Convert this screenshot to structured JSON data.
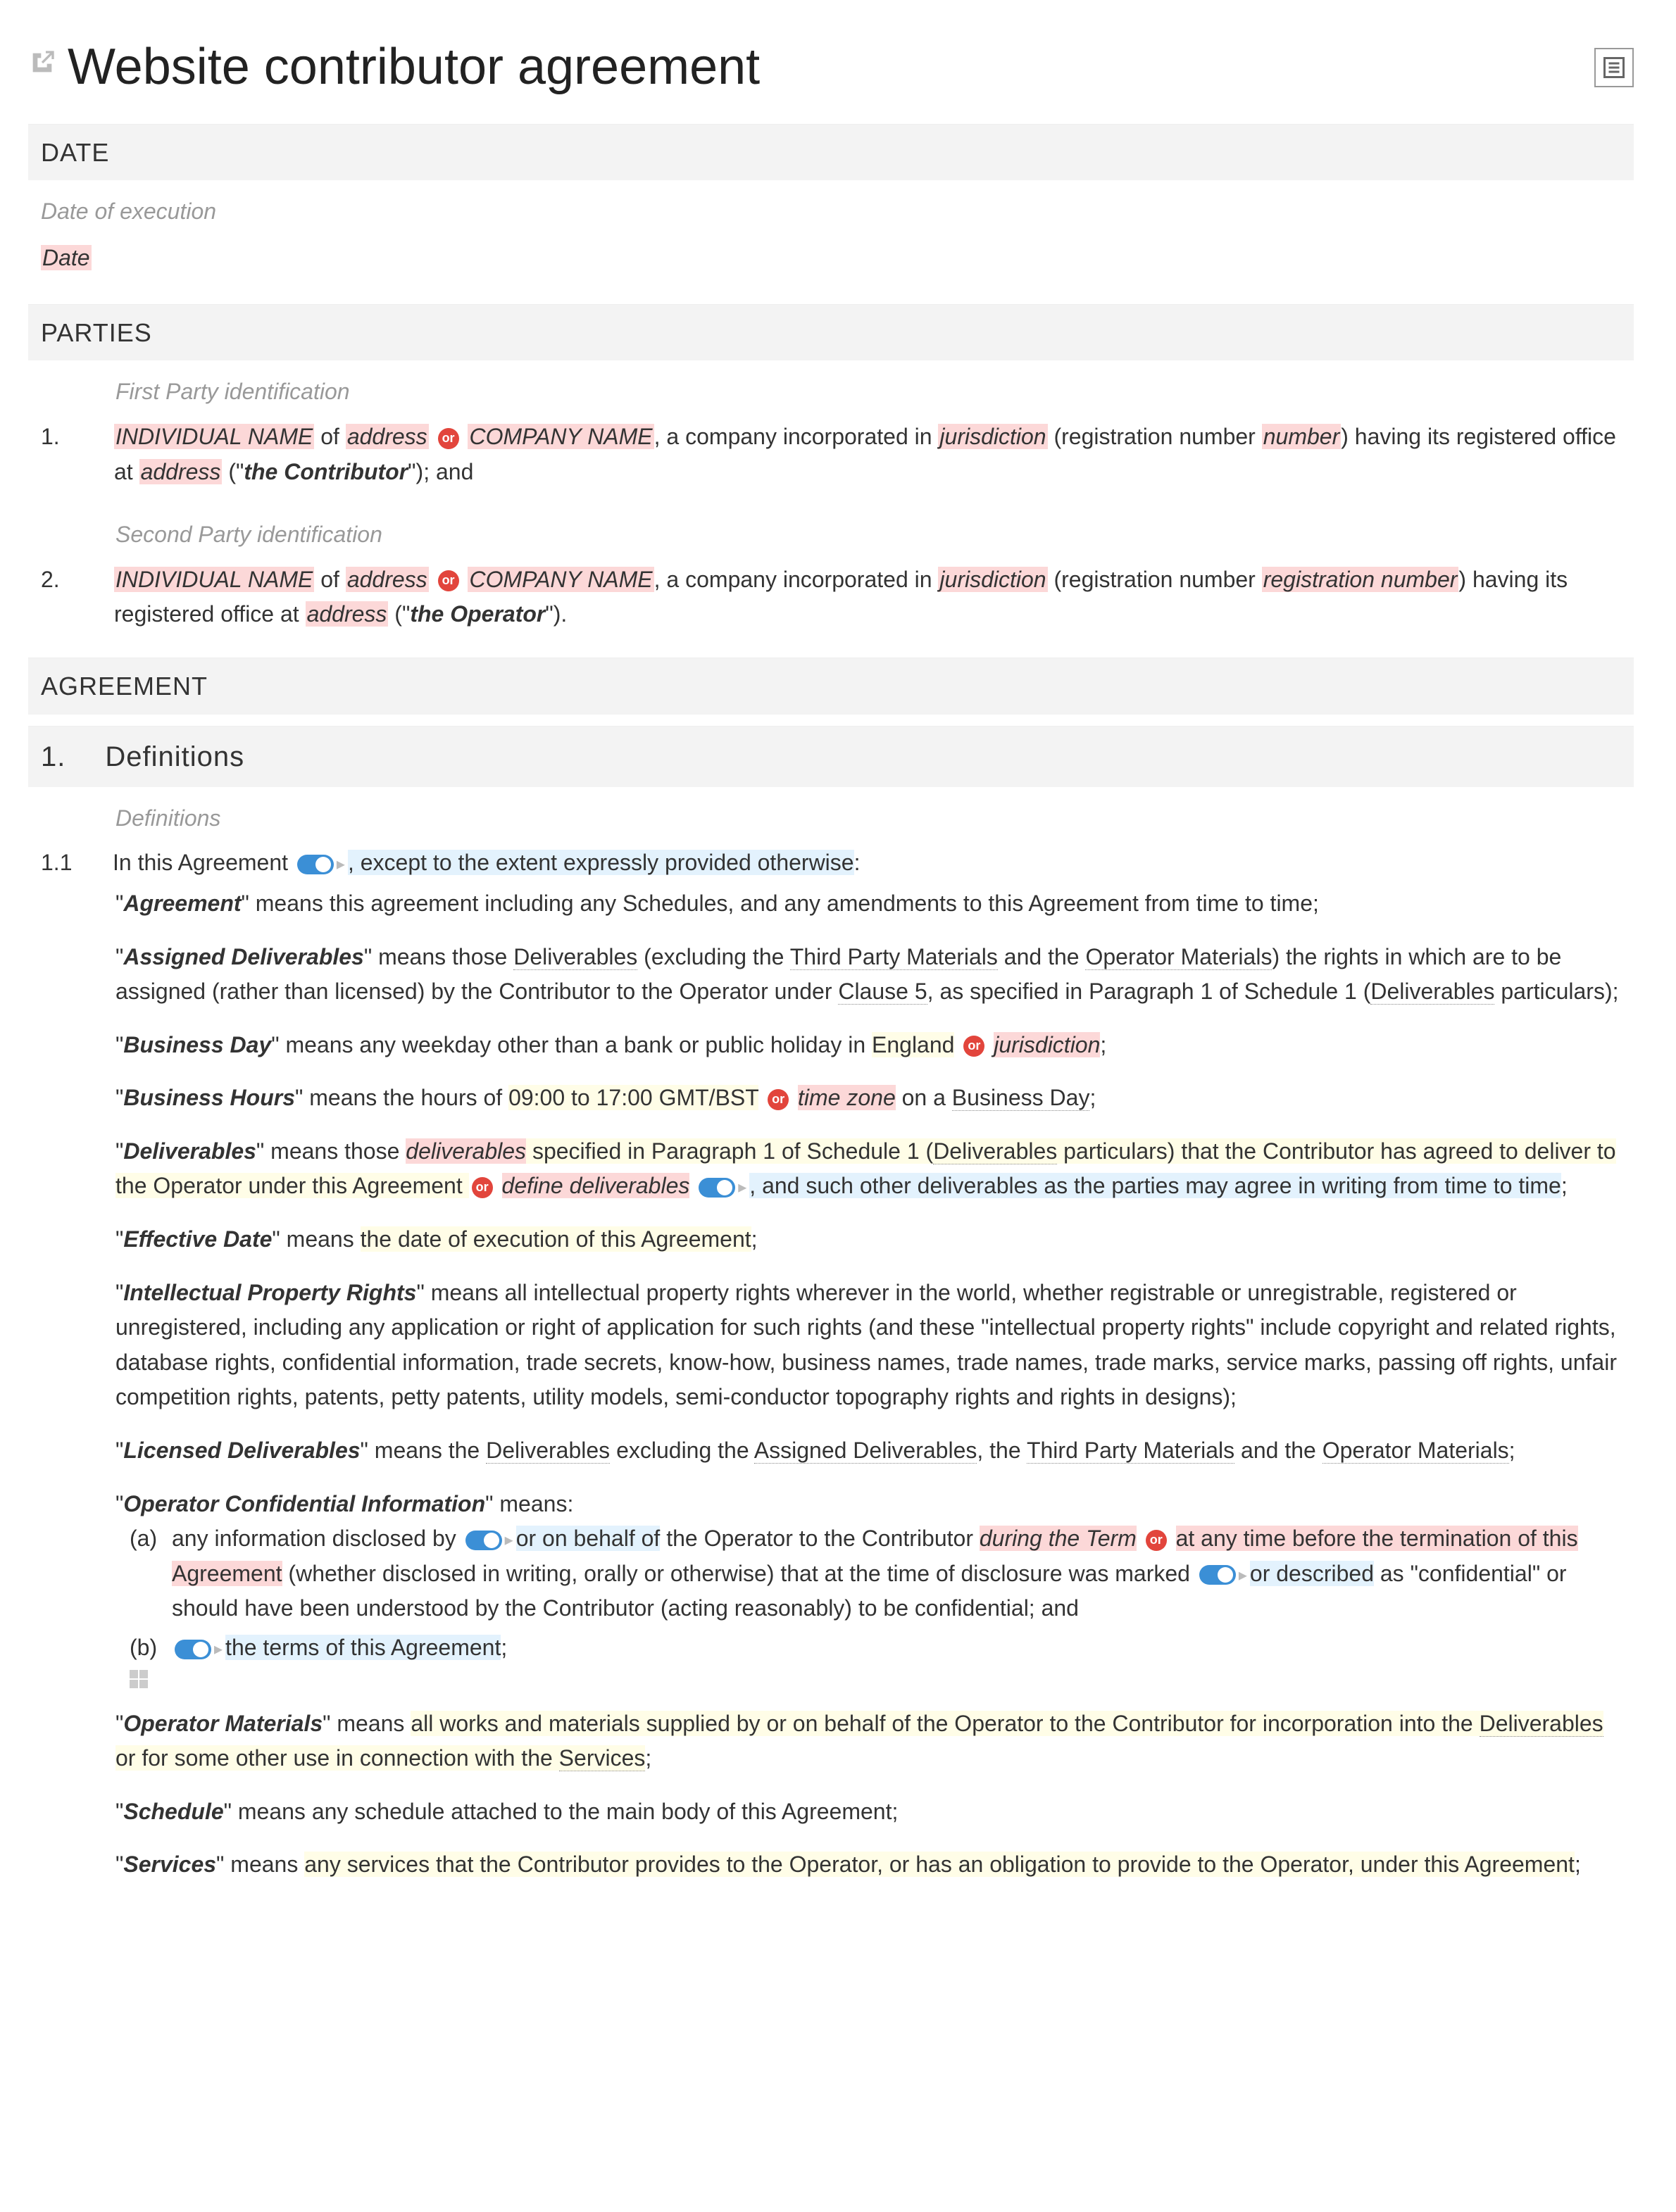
{
  "title": "Website contributor agreement",
  "sections": {
    "date": {
      "label": "DATE",
      "hint": "Date of execution",
      "placeholder": "Date"
    },
    "parties": {
      "label": "PARTIES",
      "p1_hint": "First Party identification",
      "p2_hint": "Second Party identification",
      "p1_num": "1.",
      "p2_num": "2.",
      "ph_individual": "INDIVIDUAL NAME",
      "t_of": " of ",
      "ph_address": "address",
      "or": "or",
      "ph_company": "COMPANY NAME",
      "t_company_inc": ", a company incorporated in ",
      "ph_jurisdiction": "jurisdiction",
      "t_regnum_open": " (registration number ",
      "ph_number": "number",
      "t_regnum_close": ") having its registered office at ",
      "t_open_q": " (\"",
      "role1": "the Contributor",
      "t_close_and": "\"); and",
      "ph_regnum": "registration number",
      "role2": "the Operator",
      "t_close_period": "\")."
    },
    "agreement": {
      "label": "AGREEMENT",
      "h2_num": "1.",
      "h2_title": "Definitions",
      "hint": "Definitions",
      "cl11": "1.1",
      "cl11_pre": "In this Agreement",
      "cl11_rest": ", except to the extent expressly provided otherwise",
      "cl11_colon": ":"
    }
  },
  "defs": {
    "agreement": {
      "term": "Agreement",
      "text": "\" means this agreement including any Schedules, and any amendments to this Agreement from time to time;"
    },
    "assigned": {
      "term": "Assigned Deliverables",
      "pre": "\" means those ",
      "link1": "Deliverables",
      "t2": " (excluding the ",
      "link2": "Third Party Materials",
      "t3": " and the ",
      "link3": "Operator Materials",
      "t4": ") the rights in which are to be assigned (rather than licensed) by the Contributor to the Operator under ",
      "link4": "Clause 5",
      "t5": ", as specified in Paragraph 1 of Schedule 1 (",
      "link5": "Deliverables",
      "t6": " particulars);"
    },
    "bday": {
      "term": "Business Day",
      "t1": "\" means any weekday other than a bank or public holiday in ",
      "england": "England",
      "or": "or",
      "juris": "jurisdiction",
      "semi": ";"
    },
    "bhours": {
      "term": "Business Hours",
      "t1": "\" means the hours of ",
      "hours": "09:00 to 17:00 GMT/BST",
      "or": "or",
      "tz": "time zone",
      "t2": " on a ",
      "link": "Business Day",
      "semi": ";"
    },
    "deliv": {
      "term": "Deliverables",
      "t1": "\" means those ",
      "ph1": "deliverables",
      "t2": " specified in Paragraph 1 of Schedule 1 (",
      "link1": "Deliverables",
      "t3": " particulars) that the Contributor has agreed to deliver to the Operator under this Agreement ",
      "or": "or",
      "ph2": "define deliverables",
      "t4": ", and such other deliverables as the parties may agree in writing from time to time",
      "semi": ";"
    },
    "eff": {
      "term": "Effective Date",
      "t1": "\" means ",
      "y": "the date of execution of this Agreement",
      "semi": ";"
    },
    "ipr": {
      "term": "Intellectual Property Rights",
      "body": "\" means all intellectual property rights wherever in the world, whether registrable or unregistrable, registered or unregistered, including any application or right of application for such rights (and these \"intellectual property rights\" include copyright and related rights, database rights, confidential information, trade secrets, know-how, business names, trade names, trade marks, service marks, passing off rights, unfair competition rights, patents, petty patents, utility models, semi-conductor topography rights and rights in designs);"
    },
    "licdel": {
      "term": "Licensed Deliverables",
      "t1": "\" means the ",
      "l1": "Deliverables",
      "t2": " excluding the ",
      "l2": "Assigned Deliverables",
      "t3": ", the ",
      "l3": "Third Party Materials",
      "t4": " and the ",
      "l4": "Operator Materials",
      "semi": ";"
    },
    "oci": {
      "term": "Operator Confidential Information",
      "means": "\" means:",
      "a_lbl": "(a)",
      "a_t1": "any information disclosed by ",
      "a_b1": "or on behalf of",
      "a_t2": " the Operator to the Contributor ",
      "a_p1": "during the Term",
      "a_or": "or",
      "a_p2": "at any time before the termination of this Agreement",
      "a_t3": " (whether disclosed in writing, orally or otherwise) that at the time of disclosure was marked ",
      "a_b2": "or described",
      "a_t4": " as \"confidential\" or should have been understood by the Contributor (acting reasonably) to be confidential; and",
      "b_lbl": "(b)",
      "b_t1": "the terms of this Agreement",
      "semi": ";"
    },
    "opmat": {
      "term": "Operator Materials",
      "t1": "\" means ",
      "y": "all works and materials supplied by or on behalf of the Operator to the Contributor for incorporation into the ",
      "l1": "Deliverables",
      "y2": " or for some other use in connection with the ",
      "l2": "Services",
      "semi": ";"
    },
    "sched": {
      "term": "Schedule",
      "body": "\" means any schedule attached to the main body of this Agreement;"
    },
    "svc": {
      "term": "Services",
      "t1": "\" means ",
      "y": "any services that the Contributor provides to the Operator, or has an obligation to provide to the Operator, under this Agreement",
      "semi": ";"
    }
  }
}
